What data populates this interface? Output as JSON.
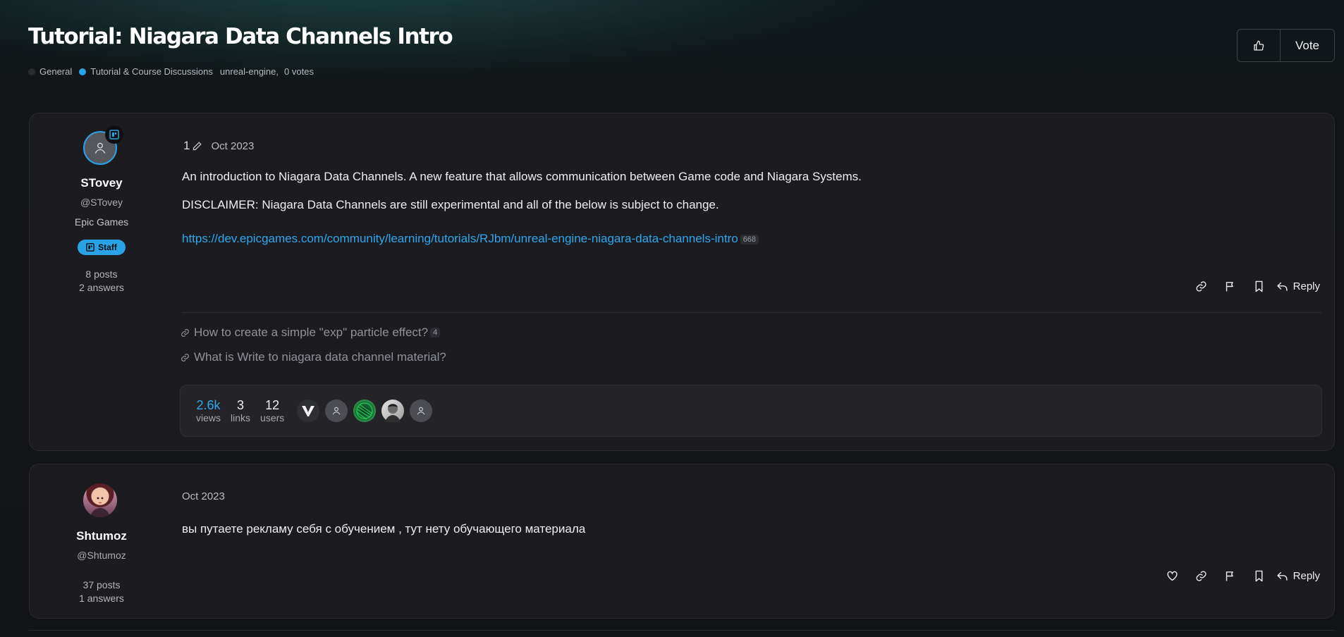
{
  "header": {
    "title": "Tutorial: Niagara Data Channels Intro",
    "categories": [
      {
        "label": "General",
        "color": "#2a2b2f"
      },
      {
        "label": "Tutorial & Course Discussions",
        "color": "#2aa3e6"
      }
    ],
    "tag": "unreal-engine",
    "tag_separator": ",",
    "votes": "0 votes",
    "vote_label": "Vote"
  },
  "posts": [
    {
      "author": {
        "name": "STovey",
        "handle": "@STovey",
        "org": "Epic Games",
        "badge": "Staff",
        "posts": "8 posts",
        "answers": "2 answers"
      },
      "edit_count": "1",
      "date": "Oct 2023",
      "paragraphs": [
        "An introduction to Niagara Data Channels. A new feature that allows communication between Game code and Niagara Systems.",
        "DISCLAIMER: Niagara Data Channels are still experimental and all of the below is subject to change."
      ],
      "link": {
        "url": "https://dev.epicgames.com/community/learning/tutorials/RJbm/unreal-engine-niagara-data-channels-intro",
        "clicks": "668"
      },
      "reply_label": "Reply",
      "related": [
        {
          "title": "How to create a simple \"exp\" particle effect?",
          "count": "4"
        },
        {
          "title": "What is Write to niagara data channel material?"
        }
      ],
      "summary": {
        "views": {
          "value": "2.6k",
          "label": "views"
        },
        "links": {
          "value": "3",
          "label": "links"
        },
        "users": {
          "value": "12",
          "label": "users"
        },
        "participants": [
          "v-logo-avatar",
          "default-avatar",
          "green-sphere-avatar",
          "photo-avatar",
          "default-avatar"
        ]
      }
    },
    {
      "author": {
        "name": "Shtumoz",
        "handle": "@Shtumoz",
        "posts": "37 posts",
        "answers": "1 answers"
      },
      "date": "Oct 2023",
      "paragraphs": [
        "вы путаете рекламу себя с обучением , тут нету обучающего материала"
      ],
      "reply_label": "Reply"
    }
  ],
  "colors": {
    "accent": "#2aa3e6",
    "background": "#121316",
    "card": "#1c1c20"
  }
}
